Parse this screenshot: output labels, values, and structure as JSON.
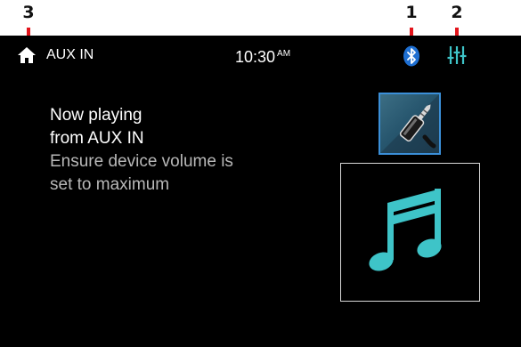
{
  "callouts": [
    {
      "number": "3",
      "target": "home"
    },
    {
      "number": "1",
      "target": "bluetooth"
    },
    {
      "number": "2",
      "target": "equalizer"
    }
  ],
  "status_bar": {
    "source": "AUX IN",
    "time": "10:30",
    "ampm": "AM",
    "icons": [
      "home-icon",
      "bluetooth-icon",
      "equalizer-icon"
    ]
  },
  "message": {
    "line1": "Now playing",
    "line2": "from AUX IN",
    "line3": "Ensure device volume is",
    "line4": "set to maximum"
  },
  "media": {
    "source_icon": "aux-cable-icon",
    "art_icon": "music-note-icon"
  },
  "colors": {
    "screen_bg": "#000000",
    "accent_cyan": "#3ec4c8",
    "bluetooth_blue": "#1e6fd2",
    "callout_red": "#e3141b"
  }
}
